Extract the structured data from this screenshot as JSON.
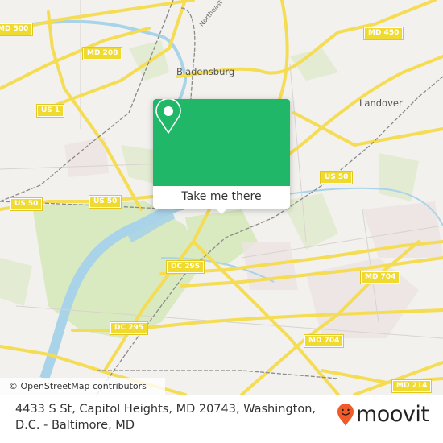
{
  "map": {
    "attribution": "© OpenStreetMap contributors",
    "places": [
      {
        "name": "Bladensburg"
      },
      {
        "name": "Landover"
      }
    ],
    "road_names": [
      "Northeast"
    ],
    "shields": [
      {
        "label": "MD 500"
      },
      {
        "label": "MD 208"
      },
      {
        "label": "MD 450"
      },
      {
        "label": "US 1"
      },
      {
        "label": "US 50"
      },
      {
        "label": "US 50"
      },
      {
        "label": "US 50"
      },
      {
        "label": "DC 295"
      },
      {
        "label": "DC 295"
      },
      {
        "label": "MD 704"
      },
      {
        "label": "MD 704"
      },
      {
        "label": "MD 214"
      }
    ],
    "colors": {
      "land": "#f2f1ed",
      "road": "#f5dc55",
      "water": "#a9d3e8",
      "park": "#d3e6b5"
    }
  },
  "popup": {
    "icon": "map-pin-icon",
    "button_label": "Take me there",
    "accent": "#20b768"
  },
  "footer": {
    "address": "4433 S St, Capitol Heights, MD 20743, Washington, D.C. - Baltimore, MD",
    "logo_text": "moovit",
    "logo_color": "#f15a29"
  }
}
